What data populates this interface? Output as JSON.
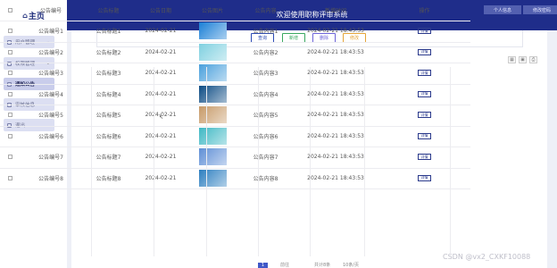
{
  "app": {
    "logo": "主页",
    "title": "欢迎使用职称评审系统",
    "header_buttons": [
      "个人信息",
      "修改密码"
    ]
  },
  "sidebar": {
    "items": [
      {
        "label": "用户管理",
        "expandable": true,
        "active": false
      },
      {
        "label": "权限管理",
        "expandable": true,
        "active": false
      },
      {
        "label": "通知公告",
        "expandable": false,
        "active": true
      },
      {
        "label": "审核信息",
        "expandable": false,
        "active": false
      },
      {
        "label": "退出",
        "expandable": false,
        "active": false
      }
    ]
  },
  "search": {
    "buttons": [
      {
        "label": "查询",
        "color": "#2d4bb5"
      },
      {
        "label": "新增",
        "color": "#3aa860"
      },
      {
        "label": "删除",
        "color": "#6c63d8"
      },
      {
        "label": "修改",
        "color": "#e4a53a"
      }
    ]
  },
  "toolbar_icons": [
    "grid-icon",
    "print-icon",
    "export-icon"
  ],
  "table": {
    "headers": [
      "公告编号",
      "公告标题",
      "公告日期",
      "公告图片",
      "公告内容",
      "新增时间",
      "操作"
    ],
    "rows": [
      {
        "no": "公告编号1",
        "title": "公告标题1",
        "date": "2024-02-21",
        "img": "#1a7fd6",
        "content": "公告内容1",
        "time": "2024-02-21 18:43:53",
        "action": "详情"
      },
      {
        "no": "公告编号2",
        "title": "公告标题2",
        "date": "2024-02-21",
        "img": "#7fd0e0",
        "content": "公告内容2",
        "time": "2024-02-21 18:43:53",
        "action": "详情"
      },
      {
        "no": "公告编号3",
        "title": "公告标题3",
        "date": "2024-02-21",
        "img": "#4aa0dc",
        "content": "公告内容3",
        "time": "2024-02-21 18:43:53",
        "action": "详情"
      },
      {
        "no": "公告编号4",
        "title": "公告标题4",
        "date": "2024-02-21",
        "img": "#0c4b84",
        "content": "公告内容4",
        "time": "2024-02-21 18:43:53",
        "action": "详情"
      },
      {
        "no": "公告编号5",
        "title": "公告标题5",
        "date": "2024-02-21",
        "img": "#c79a68",
        "content": "公告内容5",
        "time": "2024-02-21 18:43:53",
        "action": "详情"
      },
      {
        "no": "公告编号6",
        "title": "公告标题6",
        "date": "2024-02-21",
        "img": "#3fb8c4",
        "content": "公告内容6",
        "time": "2024-02-21 18:43:53",
        "action": "详情"
      },
      {
        "no": "公告编号7",
        "title": "公告标题7",
        "date": "2024-02-21",
        "img": "#5f8fd6",
        "content": "公告内容7",
        "time": "2024-02-21 18:43:53",
        "action": "详情"
      },
      {
        "no": "公告编号8",
        "title": "公告标题8",
        "date": "2024-02-21",
        "img": "#2d7fc0",
        "content": "公告内容8",
        "time": "2024-02-21 18:43:53",
        "action": "详情"
      }
    ]
  },
  "pagination": {
    "current": "1",
    "goto_label": "前往",
    "total_label": "共计8条",
    "page_size_label": "10条/页"
  },
  "watermark": "CSDN @vx2_CXKF10088"
}
